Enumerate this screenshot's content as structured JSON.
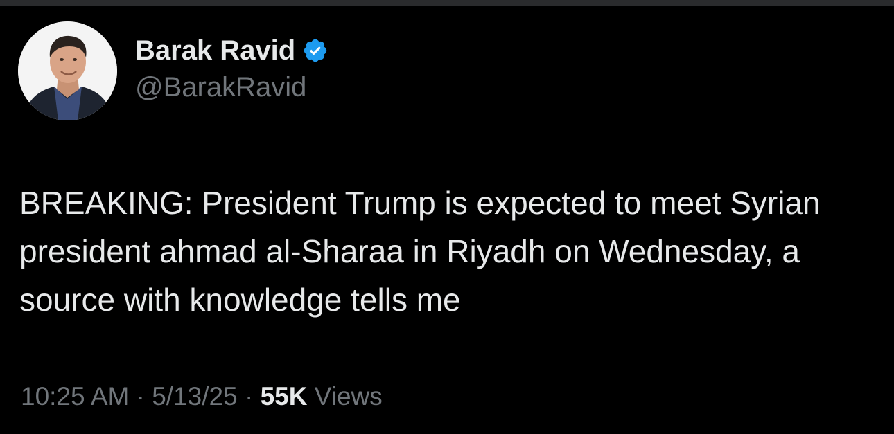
{
  "author": {
    "display_name": "Barak Ravid",
    "handle": "@BarakRavid",
    "verified": true
  },
  "tweet": {
    "text": "BREAKING: President Trump is expected to meet Syrian president ahmad al-Sharaa in Riyadh on Wednesday, a source with knowledge tells me"
  },
  "meta": {
    "time": "10:25 AM",
    "separator": " · ",
    "date": "5/13/25",
    "views_count": "55K",
    "views_label": " Views"
  },
  "colors": {
    "background": "#000000",
    "text_primary": "#e7e9ea",
    "text_secondary": "#71767b",
    "verified_badge": "#1d9bf0"
  }
}
